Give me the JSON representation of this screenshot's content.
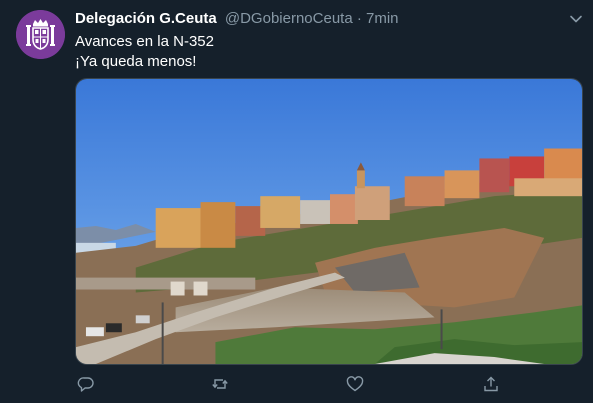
{
  "tweet": {
    "display_name": "Delegación G.Ceuta",
    "handle": "@DGobiernoCeuta",
    "separator": "·",
    "time": "7min",
    "lines": [
      "Avances en la N-352",
      "¡Ya queda menos!"
    ]
  },
  "icons": {
    "caret": "chevron-down-icon",
    "reply": "reply-icon",
    "retweet": "retweet-icon",
    "like": "heart-icon",
    "share": "share-icon"
  },
  "colors": {
    "background": "#15202b",
    "secondary_text": "#8899a6",
    "avatar_bg": "#7b3b9b"
  }
}
